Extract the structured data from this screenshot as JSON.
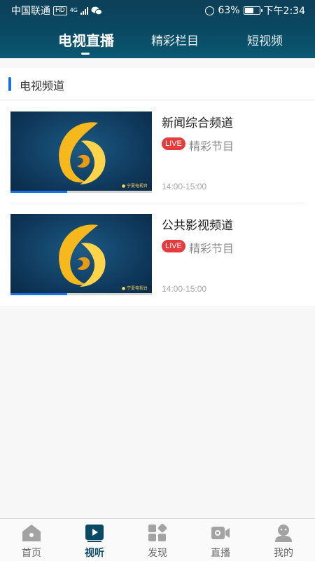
{
  "status_bar": {
    "carrier": "中国联通",
    "hd_badge": "HD",
    "network": "4G",
    "battery_percent": "63%",
    "battery_level": 0.63,
    "time": "下午2:34"
  },
  "tabs": [
    {
      "label": "电视直播",
      "active": true
    },
    {
      "label": "精彩栏目",
      "active": false
    },
    {
      "label": "短视频",
      "active": false
    }
  ],
  "section": {
    "title": "电视频道"
  },
  "channels": [
    {
      "name": "新闻综合频道",
      "live_badge": "LIVE",
      "program": "精彩节目",
      "time": "14:00-15:00",
      "progress": 0.4
    },
    {
      "name": "公共影视频道",
      "live_badge": "LIVE",
      "program": "精彩节目",
      "time": "14:00-15:00",
      "progress": 0.4
    }
  ],
  "bottom_nav": [
    {
      "label": "首页",
      "icon": "home-icon"
    },
    {
      "label": "视听",
      "icon": "video-play-icon",
      "active": true
    },
    {
      "label": "发现",
      "icon": "discover-icon"
    },
    {
      "label": "直播",
      "icon": "video-camera-icon"
    },
    {
      "label": "我的",
      "icon": "user-icon"
    }
  ],
  "colors": {
    "header": "#0a4a63",
    "accent": "#1a72e8",
    "live": "#e43c3c"
  }
}
